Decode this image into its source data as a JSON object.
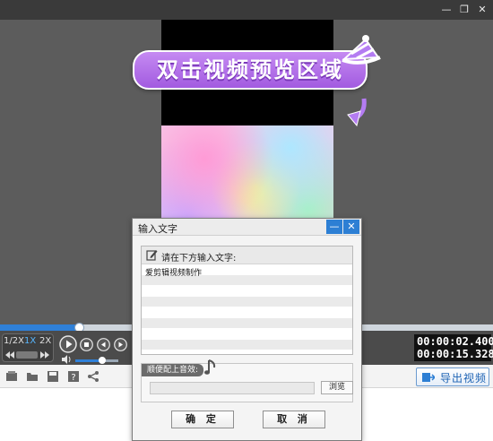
{
  "window": {
    "minimize_symbol": "—",
    "restore_symbol": "❐",
    "close_symbol": "✕"
  },
  "preview": {
    "banner_text": "双击视频预览区域"
  },
  "playback": {
    "progress_fraction": 0.16,
    "speeds": [
      "1/2X",
      "1X",
      "2X"
    ],
    "active_speed": "1X",
    "volume_fraction": 0.62,
    "current_time": "00:00:02.400",
    "total_time": "00:00:15.328"
  },
  "toolbar": {
    "export_label": "导出视频"
  },
  "dialog": {
    "title": "输入文字",
    "minimize_symbol": "—",
    "close_symbol": "✕",
    "text_section_label": "请在下方输入文字:",
    "text_value": "爱剪辑视频制作",
    "music_section_label": "顺便配上音效:",
    "music_path_value": "",
    "browse_label": "浏览",
    "ok_label": "确 定",
    "cancel_label": "取 消"
  },
  "colors": {
    "accent": "#2d7fd4",
    "banner_purple": "#a25be0",
    "stage_gray": "#5c5c5c"
  },
  "icons": {
    "window": [
      "minimize-icon",
      "restore-icon",
      "close-icon"
    ],
    "controls": [
      "play-icon",
      "stop-icon",
      "prev-frame-icon",
      "next-frame-icon",
      "volume-icon",
      "rewind-icon",
      "fast-forward-icon"
    ],
    "toolbar": [
      "new-file-icon",
      "open-folder-icon",
      "save-icon",
      "help-icon",
      "share-icon"
    ],
    "dialog": [
      "pen-icon",
      "music-note-icon"
    ]
  }
}
